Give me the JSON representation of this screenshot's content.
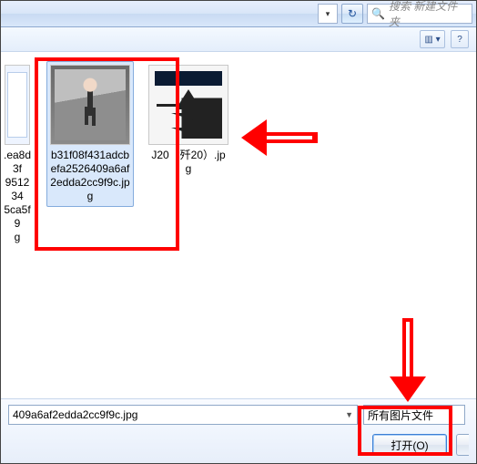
{
  "toolbar": {
    "refresh_glyph": "↻",
    "search_placeholder": "搜索 新建文件夹",
    "address_trail_glyph": "▾"
  },
  "subbar": {
    "view_glyph": "▥ ▾",
    "help_glyph": "?"
  },
  "files": {
    "partial": {
      "name_line1": ".ea8d3f",
      "name_line2": "951234",
      "name_line3": "5ca5f9",
      "name_line4": "g"
    },
    "selected": {
      "name": "b31f08f431adcbefa2526409a6af2edda2cc9f9c.jpg"
    },
    "jet": {
      "name": "J20（歼20）.jpg"
    }
  },
  "bottom": {
    "filename_value": "409a6af2edda2cc9f9c.jpg",
    "filter_label": "所有图片文件",
    "open_label": "打开(O)"
  }
}
